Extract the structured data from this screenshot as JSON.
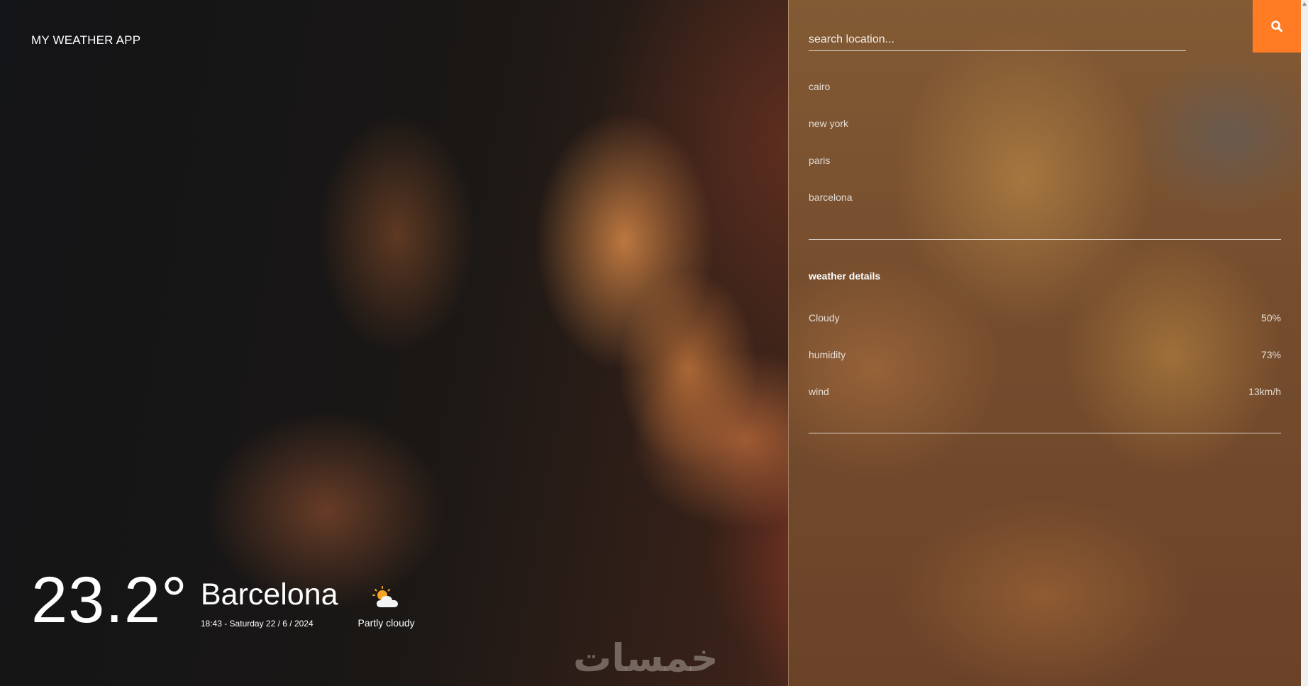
{
  "app": {
    "title": "MY WEATHER APP"
  },
  "current": {
    "temperature": "23.2°",
    "city": "Barcelona",
    "datetime": "18:43 - Saturday 22 / 6 / 2024",
    "condition": "Partly cloudy",
    "condition_icon": "partly-cloudy-icon"
  },
  "search": {
    "placeholder": "search location...",
    "value": "",
    "icon": "search-icon"
  },
  "locations": [
    "cairo",
    "new york",
    "paris",
    "barcelona"
  ],
  "details": {
    "title": "weather details",
    "rows": [
      {
        "label": "Cloudy",
        "value": "50%"
      },
      {
        "label": "humidity",
        "value": "73%"
      },
      {
        "label": "wind",
        "value": "13km/h"
      }
    ]
  },
  "watermark": "خمسات",
  "colors": {
    "accent": "#ff7b24"
  }
}
